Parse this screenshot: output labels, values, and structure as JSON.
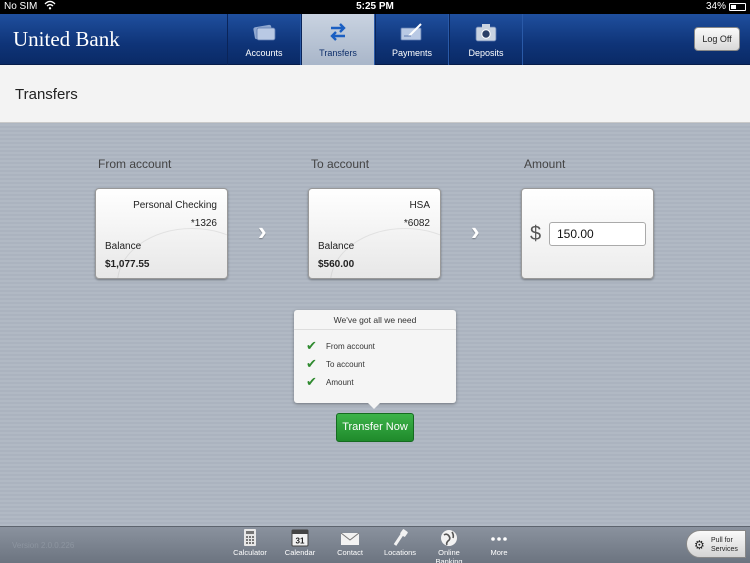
{
  "status_bar": {
    "carrier": "No SIM",
    "time": "5:25 PM",
    "battery": "34%"
  },
  "header": {
    "logo": "United Bank",
    "tabs": [
      {
        "label": "Accounts",
        "icon": "cards-icon",
        "active": false
      },
      {
        "label": "Transfers",
        "icon": "transfer-arrows-icon",
        "active": true
      },
      {
        "label": "Payments",
        "icon": "checkbook-icon",
        "active": false
      },
      {
        "label": "Deposits",
        "icon": "camera-icon",
        "active": false
      }
    ],
    "logoff_label": "Log Off"
  },
  "page": {
    "title": "Transfers"
  },
  "transfer": {
    "from_heading": "From account",
    "to_heading": "To account",
    "amount_heading": "Amount",
    "from": {
      "name": "Personal Checking",
      "number": "*1326",
      "balance_label": "Balance",
      "balance": "$1,077.55"
    },
    "to": {
      "name": "HSA",
      "number": "*6082",
      "balance_label": "Balance",
      "balance": "$560.00"
    },
    "currency_symbol": "$",
    "amount": "150.00"
  },
  "checklist": {
    "heading": "We've got all we need",
    "items": [
      "From account",
      "To account",
      "Amount"
    ]
  },
  "transfer_button": "Transfer Now",
  "toolbar": {
    "version": "Version 2.0.0.226",
    "items": [
      {
        "label": "Calendar",
        "icon": "calendar-icon",
        "calendar_day": "31"
      },
      {
        "label": "Calculator",
        "icon": "calculator-icon"
      },
      {
        "label": "Contact",
        "icon": "envelope-icon"
      },
      {
        "label": "Locations",
        "icon": "pin-icon"
      },
      {
        "label": "Online Banking",
        "icon": "globe-icon"
      },
      {
        "label": "More",
        "icon": "more-dots-icon"
      }
    ],
    "pull_label_1": "Pull for",
    "pull_label_2": "Services"
  },
  "colors": {
    "header_blue": "#0f3478",
    "accent_green": "#1f8a2b",
    "check_green": "#2f8a2f"
  }
}
